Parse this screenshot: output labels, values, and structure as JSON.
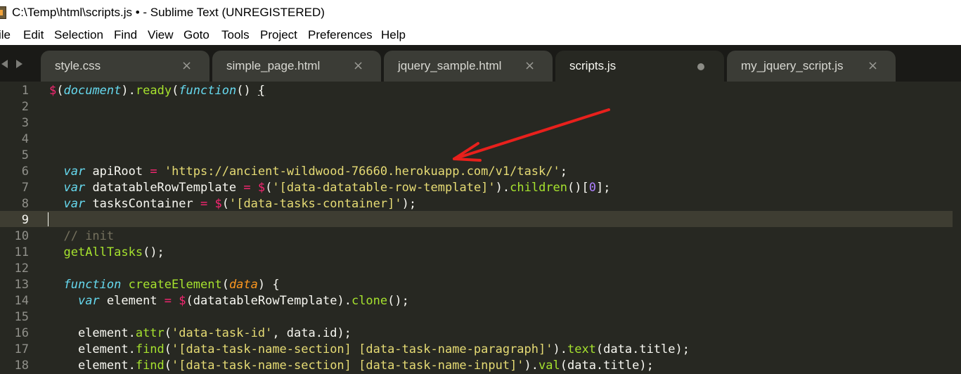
{
  "window": {
    "title": "C:\\Temp\\html\\scripts.js • - Sublime Text (UNREGISTERED)"
  },
  "menu": [
    "ile",
    "Edit",
    "Selection",
    "Find",
    "View",
    "Goto",
    "Tools",
    "Project",
    "Preferences",
    "Help"
  ],
  "tabs": [
    {
      "label": "style.css",
      "state": "close"
    },
    {
      "label": "simple_page.html",
      "state": "close"
    },
    {
      "label": "jquery_sample.html",
      "state": "close"
    },
    {
      "label": "scripts.js",
      "state": "modified",
      "active": true
    },
    {
      "label": "my_jquery_script.js",
      "state": "close"
    }
  ],
  "icons": {
    "close": "×"
  },
  "editor": {
    "current_line": 9,
    "line_numbers": [
      "1",
      "2",
      "3",
      "4",
      "5",
      "6",
      "7",
      "8",
      "9",
      "10",
      "11",
      "12",
      "13",
      "14",
      "15",
      "16",
      "17",
      "18"
    ],
    "lines": [
      "$(document).ready(function() {",
      "",
      "",
      "",
      "",
      "  var apiRoot = 'https://ancient-wildwood-76660.herokuapp.com/v1/task/';",
      "  var datatableRowTemplate = $('[data-datatable-row-template]').children()[0];",
      "  var tasksContainer = $('[data-tasks-container]');",
      "",
      "  // init",
      "  getAllTasks();",
      "",
      "  function createElement(data) {",
      "    var element = $(datatableRowTemplate).clone();",
      "",
      "    element.attr('data-task-id', data.id);",
      "    element.find('[data-task-name-section] [data-task-name-paragraph]').text(data.title);",
      "    element.find('[data-task-name-section] [data-task-name-input]').val(data.title);"
    ]
  },
  "colors": {
    "background": "#272822",
    "keyword": "#66d9ef",
    "operator": "#f92672",
    "function": "#a6e22e",
    "string": "#e6db74",
    "number": "#ae81ff",
    "comment": "#75715e",
    "annotation_arrow": "#e8201c"
  }
}
